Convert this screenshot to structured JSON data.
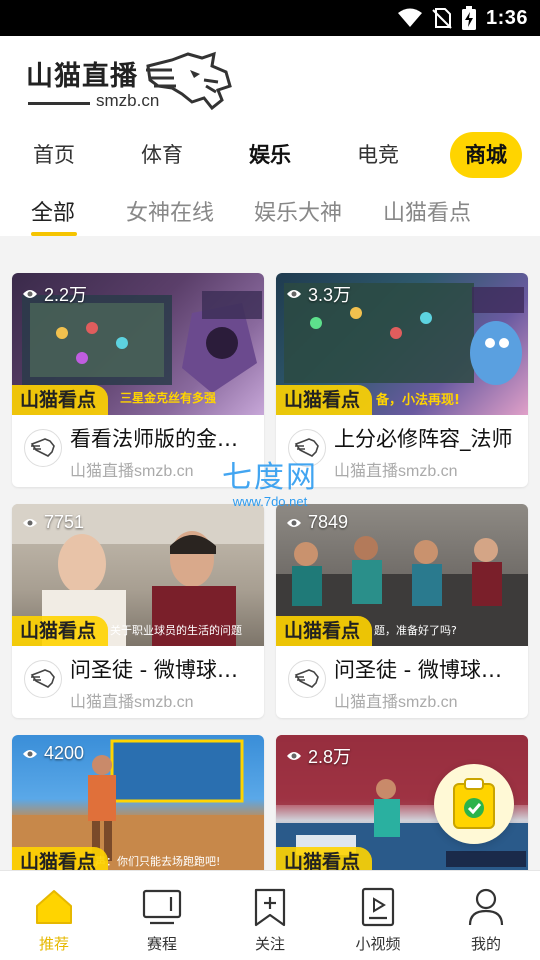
{
  "status_bar": {
    "time": "1:36"
  },
  "app": {
    "name": "山猫直播",
    "domain": "smzb.cn"
  },
  "category_tabs": [
    {
      "label": "首页"
    },
    {
      "label": "体育"
    },
    {
      "label": "娱乐"
    },
    {
      "label": "电竞"
    },
    {
      "label": "商城"
    }
  ],
  "sub_tabs": [
    {
      "label": "全部"
    },
    {
      "label": "女神在线"
    },
    {
      "label": "娱乐大神"
    },
    {
      "label": "山猫看点"
    }
  ],
  "cards": [
    {
      "views": "2.2万",
      "tag": "山猫看点",
      "title": "看看法师版的金铲铲",
      "source": "山猫直播smzb.cn",
      "thumb_caption": "三星金克丝有多强"
    },
    {
      "views": "3.3万",
      "tag": "山猫看点",
      "title": "上分必修阵容_法师",
      "source": "山猫直播smzb.cn",
      "thumb_caption": "备，小法再现!"
    },
    {
      "views": "7751",
      "tag": "山猫看点",
      "title": "问圣徒 - 微博球员访谈",
      "source": "山猫直播smzb.cn",
      "thumb_caption": "关于职业球员的生活的问题"
    },
    {
      "views": "7849",
      "tag": "山猫看点",
      "title": "问圣徒 - 微博球员访谈",
      "source": "山猫直播smzb.cn",
      "thumb_caption": "题，准备好了吗?"
    },
    {
      "views": "4200",
      "tag": "山猫看点",
      "title": "",
      "source": "",
      "thumb_caption": "说声：你们只能去场跑跑吧!"
    },
    {
      "views": "2.8万",
      "tag": "山猫看点",
      "title": "",
      "source": "",
      "thumb_caption": ""
    }
  ],
  "watermark": {
    "big": "七度网",
    "small": "www.7do.net"
  },
  "bottom_nav": [
    {
      "label": "推荐",
      "icon": "home-icon"
    },
    {
      "label": "赛程",
      "icon": "monitor-icon"
    },
    {
      "label": "关注",
      "icon": "bookmark-add-icon"
    },
    {
      "label": "小视频",
      "icon": "video-icon"
    },
    {
      "label": "我的",
      "icon": "user-icon"
    }
  ],
  "colors": {
    "accent": "#ffd400",
    "active_nav": "#e6b800"
  }
}
